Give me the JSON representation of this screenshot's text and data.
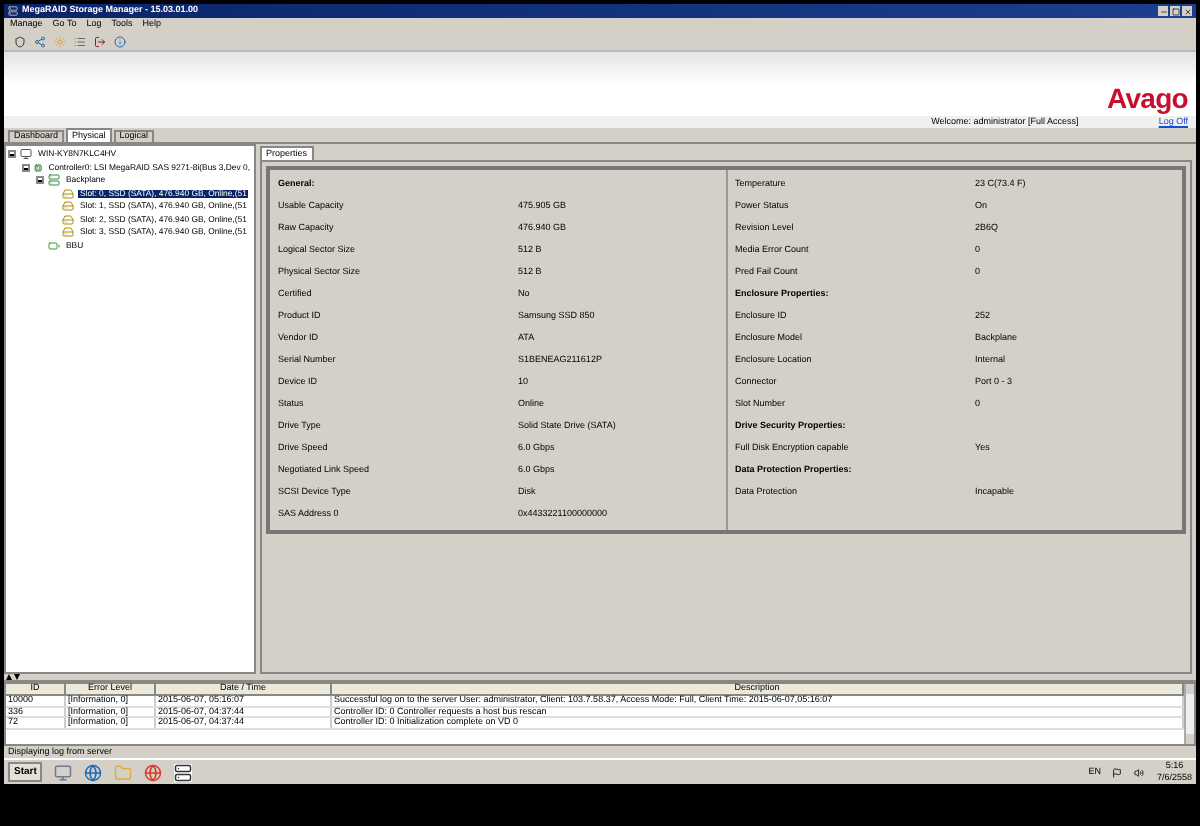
{
  "window": {
    "title": "MegaRAID Storage Manager - 15.03.01.00"
  },
  "menu": [
    "Manage",
    "Go To",
    "Log",
    "Tools",
    "Help"
  ],
  "brand": {
    "logo": "Avago",
    "welcome": "Welcome: administrator [Full Access]",
    "logoff": "Log Off"
  },
  "tabs": [
    {
      "label": "Dashboard",
      "selected": false
    },
    {
      "label": "Physical",
      "selected": true
    },
    {
      "label": "Logical",
      "selected": false
    }
  ],
  "tree": [
    {
      "kind": "server",
      "label": "WIN-KY8N7KLC4HV",
      "selected": false,
      "expanded": true,
      "children": [
        {
          "kind": "controller",
          "label": "Controller0: LSI MegaRAID SAS 9271-8i(Bus 3,Dev 0,",
          "selected": false,
          "expanded": true,
          "children": [
            {
              "kind": "enclosure",
              "label": "Backplane",
              "selected": false,
              "expanded": true,
              "children": [
                {
                  "kind": "drive",
                  "label": "Slot: 0, SSD (SATA), 476.940 GB, Online,(51",
                  "selected": true
                },
                {
                  "kind": "drive",
                  "label": "Slot: 1, SSD (SATA), 476.940 GB, Online,(51",
                  "selected": false
                },
                {
                  "kind": "drive",
                  "label": "Slot: 2, SSD (SATA), 476.940 GB, Online,(51",
                  "selected": false
                },
                {
                  "kind": "drive",
                  "label": "Slot: 3, SSD (SATA), 476.940 GB, Online,(51",
                  "selected": false
                }
              ]
            },
            {
              "kind": "bbu",
              "label": "BBU",
              "selected": false
            }
          ]
        }
      ]
    }
  ],
  "properties_tab": {
    "label": "Properties",
    "selected": true
  },
  "properties": {
    "left": [
      {
        "kind": "header",
        "label": "General:"
      },
      {
        "kind": "row",
        "label": "Usable Capacity",
        "value": "475.905 GB"
      },
      {
        "kind": "row",
        "label": "Raw Capacity",
        "value": "476.940 GB"
      },
      {
        "kind": "row",
        "label": "Logical Sector Size",
        "value": "512 B"
      },
      {
        "kind": "row",
        "label": "Physical Sector Size",
        "value": "512 B"
      },
      {
        "kind": "row",
        "label": "Certified",
        "value": "No"
      },
      {
        "kind": "row",
        "label": "Product ID",
        "value": "Samsung SSD 850"
      },
      {
        "kind": "row",
        "label": "Vendor ID",
        "value": "ATA"
      },
      {
        "kind": "row",
        "label": "Serial Number",
        "value": "S1BENEAG211612P"
      },
      {
        "kind": "row",
        "label": "Device ID",
        "value": "10"
      },
      {
        "kind": "row",
        "label": "Status",
        "value": "Online"
      },
      {
        "kind": "row",
        "label": "Drive Type",
        "value": "Solid State Drive (SATA)"
      },
      {
        "kind": "row",
        "label": "Drive Speed",
        "value": "6.0 Gbps"
      },
      {
        "kind": "row",
        "label": "Negotiated Link Speed",
        "value": "6.0 Gbps"
      },
      {
        "kind": "row",
        "label": "SCSI Device Type",
        "value": "Disk"
      },
      {
        "kind": "row",
        "label": "SAS Address 0",
        "value": "0x4433221100000000"
      }
    ],
    "right": [
      {
        "kind": "row",
        "label": "Temperature",
        "value": "23 C(73.4 F)"
      },
      {
        "kind": "row",
        "label": "Power Status",
        "value": "On"
      },
      {
        "kind": "row",
        "label": "Revision Level",
        "value": "2B6Q"
      },
      {
        "kind": "row",
        "label": "Media Error Count",
        "value": "0"
      },
      {
        "kind": "row",
        "label": "Pred Fail Count",
        "value": "0"
      },
      {
        "kind": "header",
        "label": "Enclosure Properties:"
      },
      {
        "kind": "row",
        "label": "Enclosure ID",
        "value": "252"
      },
      {
        "kind": "row",
        "label": "Enclosure Model",
        "value": "Backplane"
      },
      {
        "kind": "row",
        "label": "Enclosure Location",
        "value": "Internal"
      },
      {
        "kind": "row",
        "label": "Connector",
        "value": "Port 0 - 3"
      },
      {
        "kind": "row",
        "label": "Slot Number",
        "value": "0"
      },
      {
        "kind": "header",
        "label": "Drive Security Properties:"
      },
      {
        "kind": "row",
        "label": "Full Disk Encryption capable",
        "value": "Yes"
      },
      {
        "kind": "header",
        "label": "Data Protection Properties:"
      },
      {
        "kind": "row",
        "label": "Data Protection",
        "value": "Incapable"
      }
    ]
  },
  "log": {
    "columns": [
      "ID",
      "Error Level",
      "Date / Time",
      "Description"
    ],
    "rows": [
      [
        "10000",
        "[Information, 0]",
        "2015-06-07, 05:16:07",
        "Successful log on to the server User:  administrator, Client:  103.7.58.37,    Access Mode:  Full, Client Time:  2015-06-07,05:16:07"
      ],
      [
        "336",
        "[Information, 0]",
        "2015-06-07, 04:37:44",
        "Controller ID:  0   Controller requests a host bus rescan"
      ],
      [
        "72",
        "[Information, 0]",
        "2015-06-07, 04:37:44",
        "Controller ID:  0   Initialization complete on VD     0"
      ]
    ],
    "status": "Displaying log from server"
  },
  "taskbar": {
    "start": "Start",
    "language": "EN",
    "time": "5:16",
    "date": "7/6/2558"
  }
}
